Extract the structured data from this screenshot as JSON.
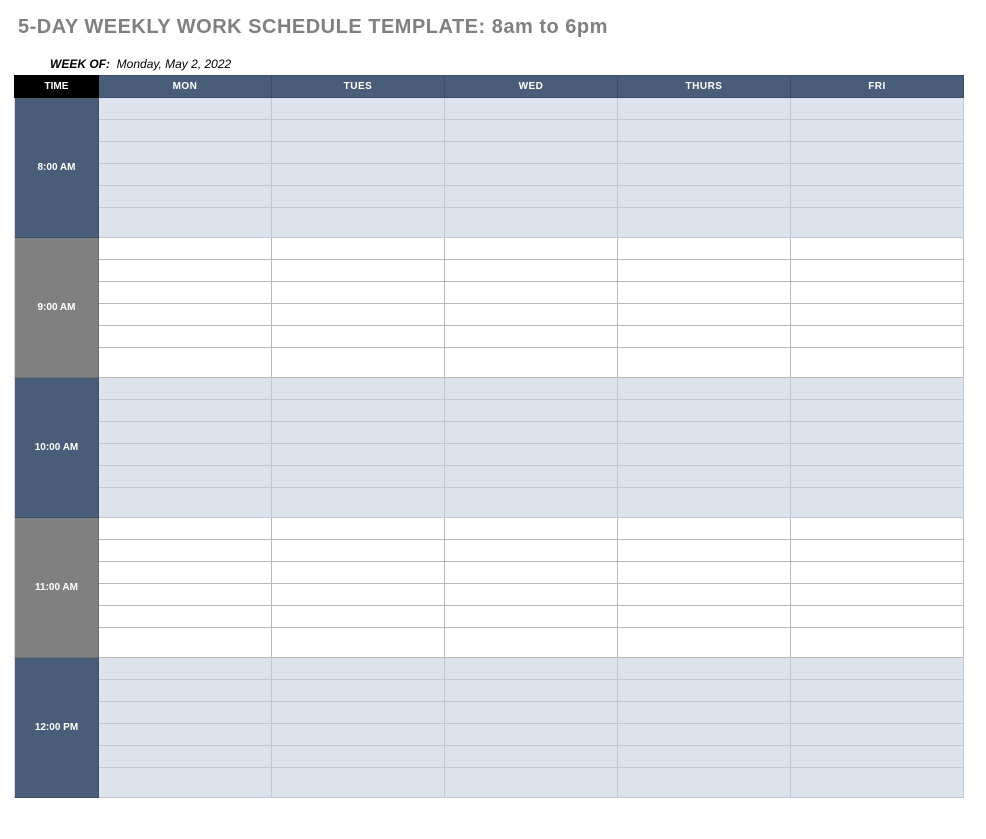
{
  "title": "5-DAY WEEKLY WORK SCHEDULE TEMPLATE: 8am to 6pm",
  "week_of_label": "WEEK OF:",
  "week_of_value": "Monday, May 2, 2022",
  "headers": {
    "time": "TIME",
    "days": [
      "MON",
      "TUES",
      "WED",
      "THURS",
      "FRI"
    ]
  },
  "timeslots": [
    {
      "label": "8:00 AM",
      "style": "blue",
      "rows": 6
    },
    {
      "label": "9:00 AM",
      "style": "gray",
      "rows": 6
    },
    {
      "label": "10:00 AM",
      "style": "blue",
      "rows": 6
    },
    {
      "label": "11:00 AM",
      "style": "gray",
      "rows": 6
    },
    {
      "label": "12:00 PM",
      "style": "blue",
      "rows": 6
    }
  ]
}
